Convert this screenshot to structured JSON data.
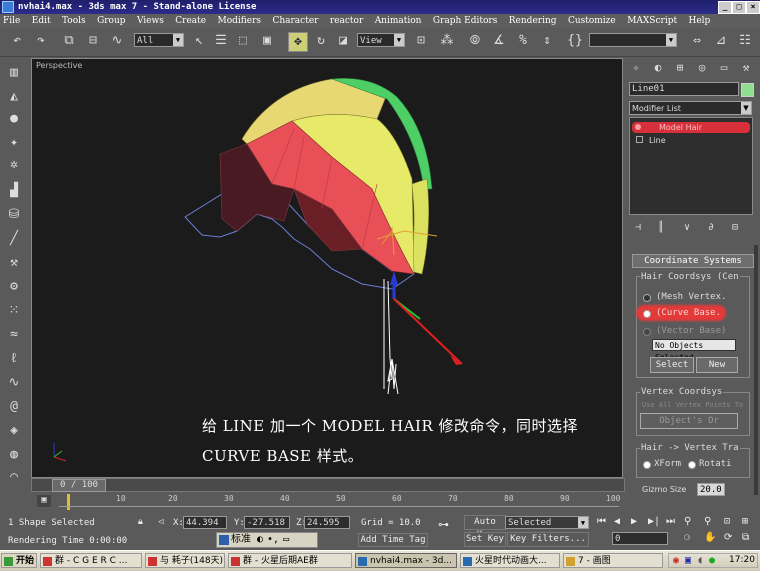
{
  "window": {
    "title": "nvhai4.max - 3ds max 7 - Stand-alone License"
  },
  "menu": [
    "File",
    "Edit",
    "Tools",
    "Group",
    "Views",
    "Create",
    "Modifiers",
    "Character",
    "reactor",
    "Animation",
    "Graph Editors",
    "Rendering",
    "Customize",
    "MAXScript",
    "Help"
  ],
  "toolbar": {
    "selection_filter": "All",
    "ref_coord": "View",
    "named_selection": ""
  },
  "viewport": {
    "label": "Perspective",
    "caption_line1": "给 LINE 加一个 MODEL HAIR 修改命令，同时选择",
    "caption_line2": "CURVE BASE 样式。"
  },
  "panel": {
    "object_name": "Line01",
    "object_color": "#8fdf8f",
    "modifier_list": "Modifier List",
    "stack": [
      "Model Hair",
      "Line"
    ],
    "coord_rollout": "Coordinate Systems",
    "hair_group": "Hair Coordsys (Cen",
    "radio_mesh": "(Mesh Vertex.",
    "radio_curve": "(Curve Base.",
    "radio_vector": "(Vector Base)",
    "no_objects": "No Objects Selected",
    "select_btn": "Select",
    "new_btn": "New",
    "vertex_group": "Vertex Coordsys",
    "vertex_sub": "Use All Vertex Points To",
    "object_or": "Object's Or",
    "hair_vertex": "Hair -> Vertex Tra",
    "xform": "XForm",
    "rotati": "Rotati",
    "gizmo_label": "Gizmo Size",
    "gizmo_value": "20.0"
  },
  "timeline": {
    "frame": "0 / 100",
    "ticks": [
      "10",
      "20",
      "30",
      "40",
      "50",
      "60",
      "70",
      "80",
      "90",
      "100"
    ]
  },
  "status": {
    "selected": "1 Shape Selected",
    "x": "44.394",
    "y": "-27.518",
    "z": "24.595",
    "grid": "Grid = 10.0",
    "autokey": "Auto Key",
    "setkey": "Set Key",
    "sel_filter": "Selected",
    "keyfilters": "Key Filters...",
    "rendering_time": "Rendering Time  0:00:00",
    "ime": "标准",
    "add_time_tag": "Add Time Tag",
    "frame_field": "0"
  },
  "taskbar": {
    "start": "开始",
    "tasks": [
      "群 - C G E R C ...",
      "与 耗子(148天)",
      "群 - 火星后期AE群",
      "nvhai4.max - 3d...",
      "火星时代动画大...",
      "7 - 画图"
    ],
    "clock": "17:20"
  }
}
